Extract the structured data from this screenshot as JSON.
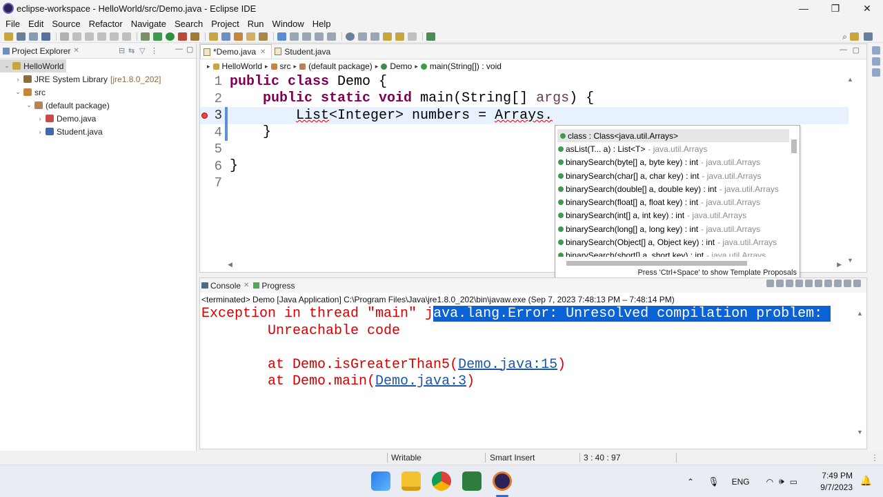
{
  "window": {
    "title": "eclipse-workspace - HelloWorld/src/Demo.java - Eclipse IDE",
    "minimize": "—",
    "maximize": "❐",
    "close": "✕"
  },
  "menu": [
    "File",
    "Edit",
    "Source",
    "Refactor",
    "Navigate",
    "Search",
    "Project",
    "Run",
    "Window",
    "Help"
  ],
  "explorer": {
    "title": "Project Explorer",
    "tree": [
      {
        "label": "HelloWorld",
        "indent": 0,
        "twisty": "⌄",
        "icon": "project-icon",
        "deco": "",
        "selected": true
      },
      {
        "label": "JRE System Library",
        "indent": 1,
        "twisty": "›",
        "icon": "library-icon",
        "deco": "[jre1.8.0_202]",
        "selected": false
      },
      {
        "label": "src",
        "indent": 1,
        "twisty": "⌄",
        "icon": "source-folder-icon",
        "deco": "",
        "selected": false
      },
      {
        "label": "(default package)",
        "indent": 2,
        "twisty": "⌄",
        "icon": "package-icon",
        "deco": "",
        "selected": false
      },
      {
        "label": "Demo.java",
        "indent": 3,
        "twisty": "›",
        "icon": "java-file-error-icon",
        "deco": "",
        "selected": false
      },
      {
        "label": "Student.java",
        "indent": 3,
        "twisty": "›",
        "icon": "java-file-icon",
        "deco": "",
        "selected": false
      }
    ]
  },
  "editor": {
    "tabs": [
      {
        "label": "*Demo.java",
        "active": true
      },
      {
        "label": "Student.java",
        "active": false
      }
    ],
    "breadcrumb": [
      "HelloWorld",
      "src",
      "(default package)",
      "Demo",
      "main(String[]) : void"
    ],
    "lines": [
      {
        "num": "1",
        "text": "public class Demo {"
      },
      {
        "num": "2",
        "text": "    public static void main(String[] args) {"
      },
      {
        "num": "3",
        "text": "        List<Integer> numbers = Arrays."
      },
      {
        "num": "4",
        "text": "    }"
      },
      {
        "num": "5",
        "text": ""
      },
      {
        "num": "6",
        "text": "}"
      },
      {
        "num": "7",
        "text": ""
      }
    ],
    "current_line": 3
  },
  "content_assist": {
    "items": [
      {
        "sig": "class : Class<java.util.Arrays>",
        "owner": ""
      },
      {
        "sig": "asList(T... a) : List<T>",
        "owner": "- java.util.Arrays"
      },
      {
        "sig": "binarySearch(byte[] a, byte key) : int",
        "owner": "- java.util.Arrays"
      },
      {
        "sig": "binarySearch(char[] a, char key) : int",
        "owner": "- java.util.Arrays"
      },
      {
        "sig": "binarySearch(double[] a, double key) : int",
        "owner": "- java.util.Arrays"
      },
      {
        "sig": "binarySearch(float[] a, float key) : int",
        "owner": "- java.util.Arrays"
      },
      {
        "sig": "binarySearch(int[] a, int key) : int",
        "owner": "- java.util.Arrays"
      },
      {
        "sig": "binarySearch(long[] a, long key) : int",
        "owner": "- java.util.Arrays"
      },
      {
        "sig": "binarySearch(Object[] a, Object key) : int",
        "owner": "- java.util.Arrays"
      },
      {
        "sig": "binarySearch(short[] a, short key) : int",
        "owner": "- java.util.Arrays"
      }
    ],
    "status": "Press 'Ctrl+Space' to show Template Proposals"
  },
  "console": {
    "tabs": [
      "Console",
      "Progress"
    ],
    "info": "<terminated> Demo [Java Application] C:\\Program Files\\Java\\jre1.8.0_202\\bin\\javaw.exe  (Sep 7, 2023 7:48:13 PM – 7:48:14 PM)",
    "line1_pre": "Exception in thread \"main\" j",
    "line1_hl": "ava.lang.Error: Unresolved compilation problem: ",
    "line2": "        Unreachable code",
    "line4_pre": "        at Demo.isGreaterThan5(",
    "line4_link": "Demo.java:15",
    "line5_pre": "        at Demo.main(",
    "line5_link": "Demo.java:3",
    "close_paren": ")"
  },
  "status": {
    "writable": "Writable",
    "insert_mode": "Smart Insert",
    "position": "3 : 40 : 97"
  },
  "taskbar": {
    "lang": "ENG",
    "time": "7:49 PM",
    "date": "9/7/2023"
  },
  "colors": {
    "keyword": "#7f0055",
    "error": "#d60000",
    "selection": "#0a62d4",
    "current_line": "#e8f2fe"
  }
}
